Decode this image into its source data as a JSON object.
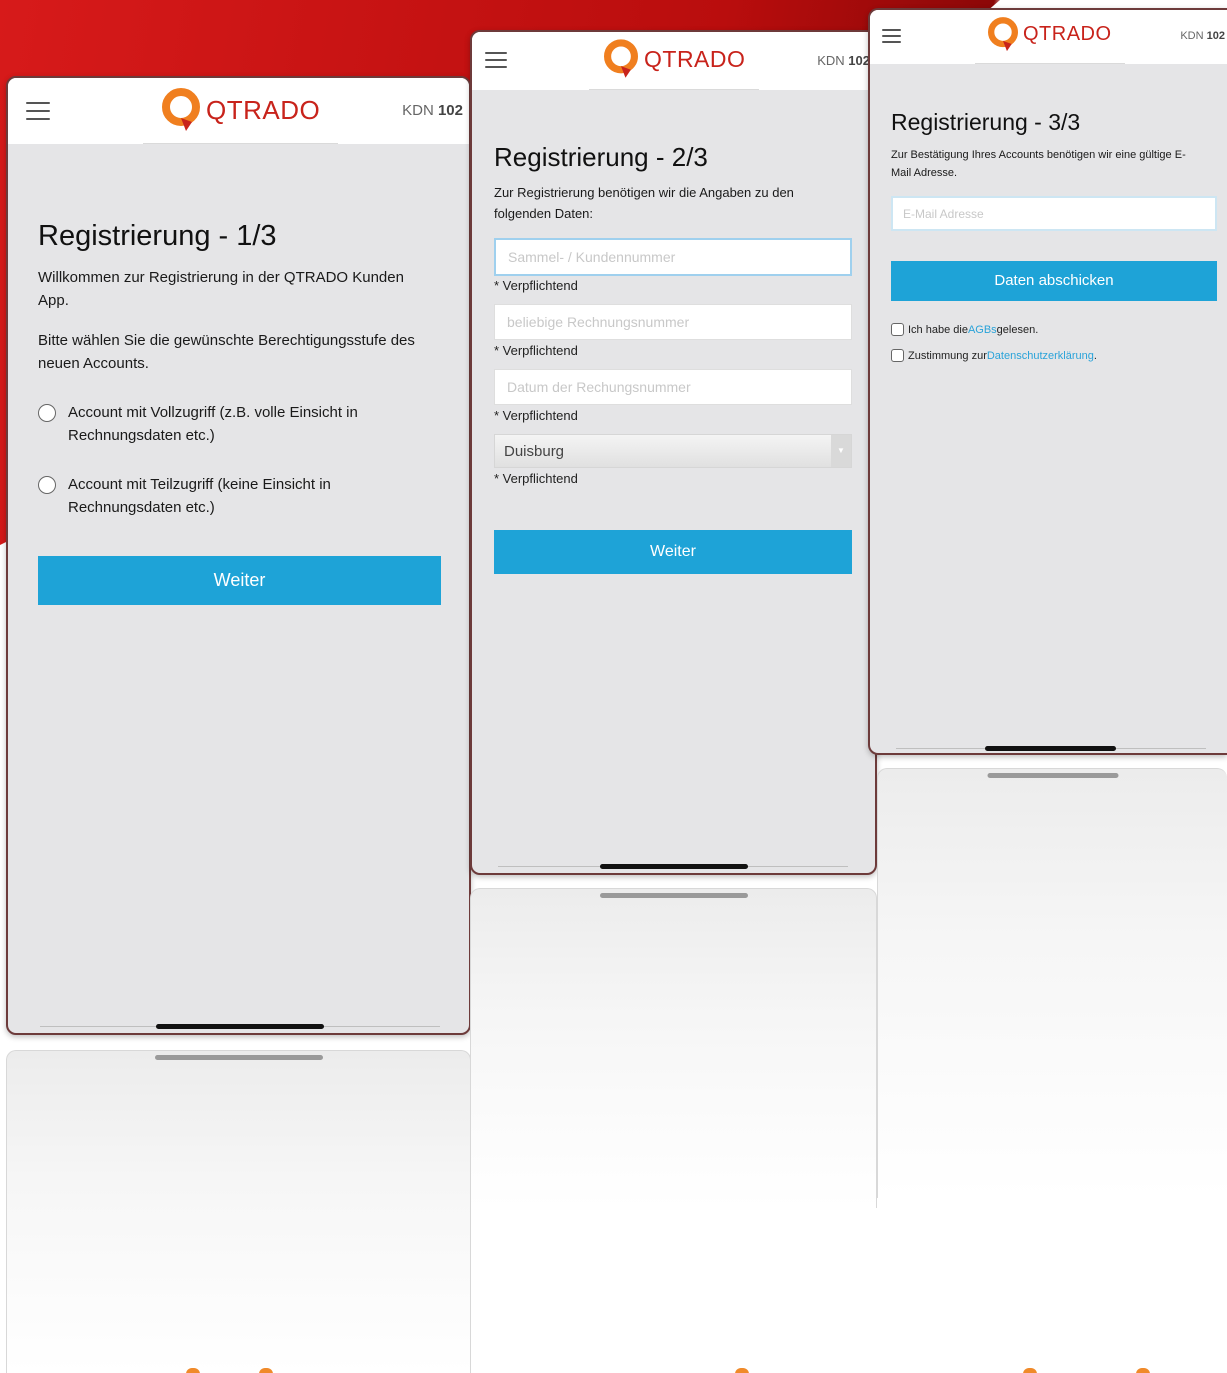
{
  "brand": {
    "logo_text": "QTRADO",
    "kdn_prefix": "KDN",
    "kdn_number": "102",
    "logo_color": "#c8231b",
    "accent": "#1ea3d7"
  },
  "screen1": {
    "title": "Registrierung - 1/3",
    "intro": "Willkommen zur Registrierung in der QTRADO Kunden App.",
    "prompt": "Bitte wählen Sie die gewünschte Berechtigungsstufe des neuen Accounts.",
    "options": [
      {
        "label": "Account mit Vollzugriff (z.B. volle Einsicht in Rechnungsdaten etc.)"
      },
      {
        "label": "Account mit Teilzugriff (keine Einsicht in Rechnungsdaten etc.)"
      }
    ],
    "button_label": "Weiter"
  },
  "screen2": {
    "title": "Registrierung - 2/3",
    "intro": "Zur Registrierung benötigen wir die Angaben zu den folgenden Daten:",
    "fields": [
      {
        "placeholder": "Sammel- / Kundennummer",
        "required": "* Verpflichtend"
      },
      {
        "placeholder": "beliebige Rechnungsnummer",
        "required": "* Verpflichtend"
      },
      {
        "placeholder": "Datum der Rechungsnummer",
        "required": "* Verpflichtend"
      }
    ],
    "select": {
      "value": "Duisburg",
      "required": "* Verpflichtend"
    },
    "button_label": "Weiter"
  },
  "screen3": {
    "title": "Registrierung - 3/3",
    "intro": "Zur Bestätigung Ihres Accounts benötigen wir eine gültige E-Mail Adresse.",
    "email_placeholder": "E-Mail Adresse",
    "button_label": "Daten abschicken",
    "check1": {
      "before": "Ich habe die ",
      "link": "AGBs",
      "after": " gelesen."
    },
    "check2": {
      "before": "Zustimmung zur ",
      "link": "Datenschutzerklärung",
      "after": "."
    }
  }
}
